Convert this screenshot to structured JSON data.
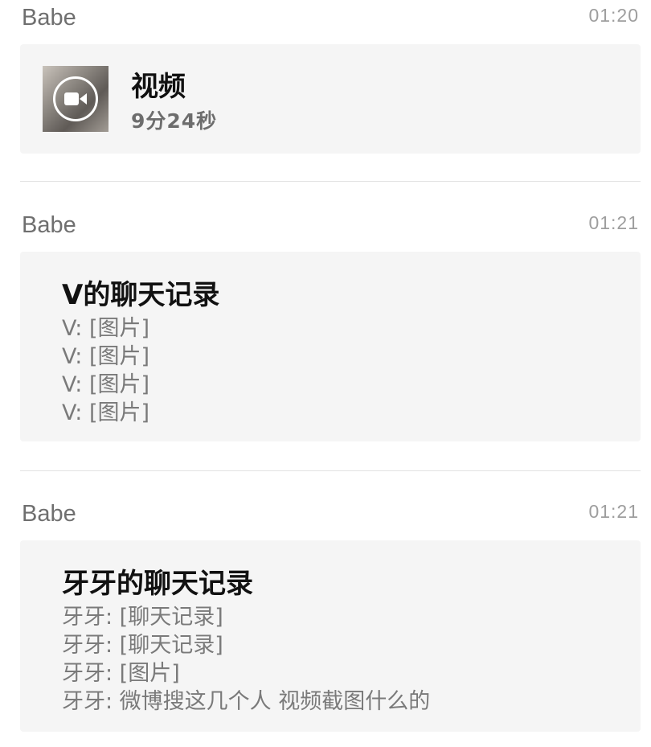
{
  "messages": [
    {
      "sender": "Babe",
      "time": "01:20",
      "video": {
        "title": "视频",
        "duration": "9分24秒",
        "icon": "video-camera-icon"
      }
    },
    {
      "sender": "Babe",
      "time": "01:21",
      "history": {
        "title": "V的聊天记录",
        "lines": [
          "V: [图片]",
          "V: [图片]",
          "V: [图片]",
          "V: [图片]"
        ]
      }
    },
    {
      "sender": "Babe",
      "time": "01:21",
      "history": {
        "title": "牙牙的聊天记录",
        "lines": [
          "牙牙: [聊天记录]",
          "牙牙: [聊天记录]",
          "牙牙: [图片]",
          "牙牙: 微博搜这几个人 视频截图什么的"
        ]
      }
    }
  ]
}
